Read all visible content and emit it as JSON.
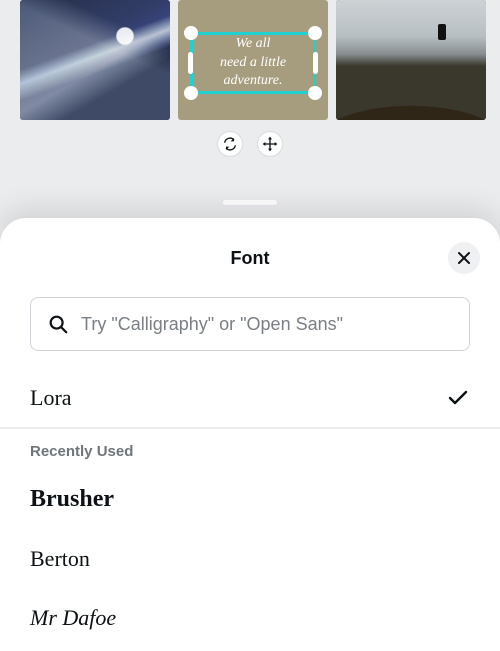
{
  "canvas": {
    "selected_text": "We all\nneed a little\nadventure."
  },
  "toolbar": {
    "sync_btn": "sync",
    "move_btn": "move"
  },
  "sheet": {
    "title": "Font",
    "search_placeholder": "Try \"Calligraphy\" or \"Open Sans\"",
    "selected_font": "Lora",
    "recent_label": "Recently Used",
    "recent_fonts": [
      "Brusher",
      "Berton",
      "Mr Dafoe"
    ]
  }
}
